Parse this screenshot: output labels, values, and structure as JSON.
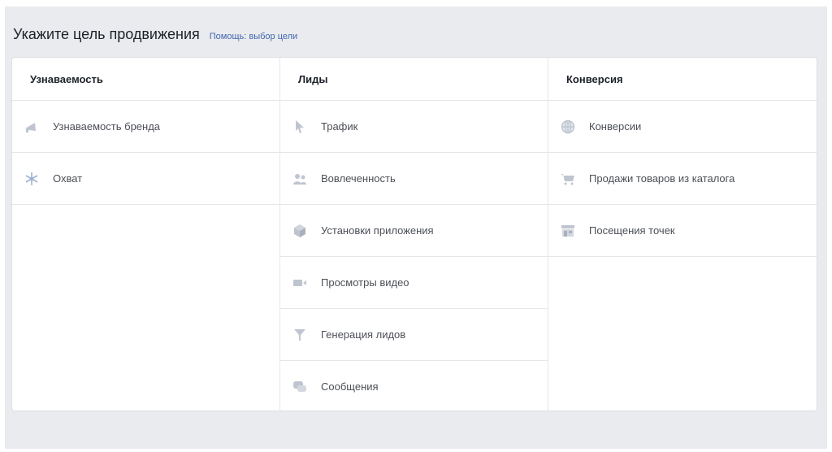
{
  "header": {
    "title": "Укажите цель продвижения",
    "help_link": "Помощь: выбор цели"
  },
  "colors": {
    "icon": "#bfc5d0",
    "link": "#4267b2",
    "background": "#e9ebee"
  },
  "columns": [
    {
      "title": "Узнаваемость",
      "items": [
        {
          "label": "Узнаваемость бренда",
          "icon": "megaphone-icon"
        },
        {
          "label": "Охват",
          "icon": "snowflake-icon"
        }
      ]
    },
    {
      "title": "Лиды",
      "items": [
        {
          "label": "Трафик",
          "icon": "cursor-icon"
        },
        {
          "label": "Вовлеченность",
          "icon": "people-icon"
        },
        {
          "label": "Установки приложения",
          "icon": "cube-icon"
        },
        {
          "label": "Просмотры видео",
          "icon": "video-camera-icon"
        },
        {
          "label": "Генерация лидов",
          "icon": "funnel-icon"
        },
        {
          "label": "Сообщения",
          "icon": "chat-bubbles-icon"
        }
      ]
    },
    {
      "title": "Конверсия",
      "items": [
        {
          "label": "Конверсии",
          "icon": "globe-icon"
        },
        {
          "label": "Продажи товаров из каталога",
          "icon": "cart-icon"
        },
        {
          "label": "Посещения точек",
          "icon": "store-icon"
        }
      ]
    }
  ]
}
